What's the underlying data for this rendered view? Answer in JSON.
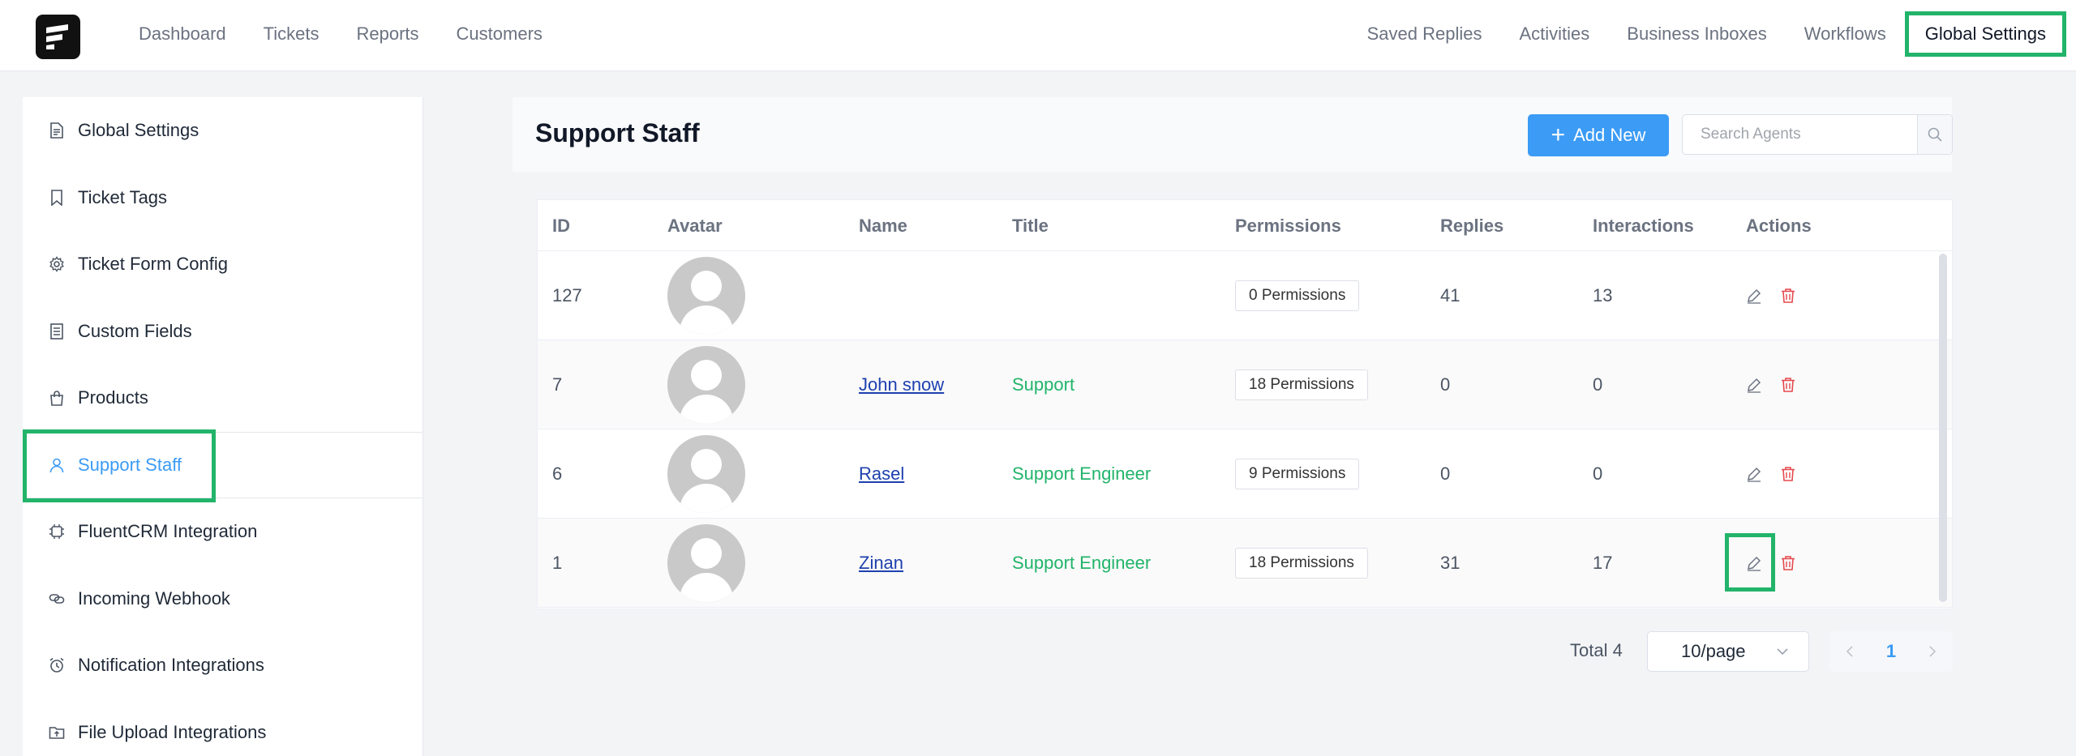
{
  "topnav": {
    "left": [
      "Dashboard",
      "Tickets",
      "Reports",
      "Customers"
    ],
    "right": [
      "Saved Replies",
      "Activities",
      "Business Inboxes",
      "Workflows"
    ],
    "active": "Global Settings"
  },
  "sidebar": {
    "items": [
      {
        "label": "Global Settings",
        "icon": "document-icon"
      },
      {
        "label": "Ticket Tags",
        "icon": "bookmark-icon"
      },
      {
        "label": "Ticket Form Config",
        "icon": "gear-icon"
      },
      {
        "label": "Custom Fields",
        "icon": "list-document-icon"
      },
      {
        "label": "Products",
        "icon": "shopping-bag-icon"
      },
      {
        "label": "Support Staff",
        "icon": "user-icon"
      },
      {
        "label": "FluentCRM Integration",
        "icon": "chip-icon"
      },
      {
        "label": "Incoming Webhook",
        "icon": "link-icon"
      },
      {
        "label": "Notification Integrations",
        "icon": "alarm-clock-icon"
      },
      {
        "label": "File Upload Integrations",
        "icon": "folder-upload-icon"
      }
    ],
    "active_index": 5
  },
  "page": {
    "title": "Support Staff",
    "add_label": "Add New",
    "search_placeholder": "Search Agents"
  },
  "table": {
    "columns": [
      "ID",
      "Avatar",
      "Name",
      "Title",
      "Permissions",
      "Replies",
      "Interactions",
      "Actions"
    ],
    "rows": [
      {
        "id": "127",
        "name": "",
        "title": "",
        "permissions": "0 Permissions",
        "replies": "41",
        "interactions": "13"
      },
      {
        "id": "7",
        "name": "John snow",
        "title": "Support",
        "permissions": "18 Permissions",
        "replies": "0",
        "interactions": "0"
      },
      {
        "id": "6",
        "name": "Rasel",
        "title": "Support Engineer",
        "permissions": "9 Permissions",
        "replies": "0",
        "interactions": "0"
      },
      {
        "id": "1",
        "name": "Zinan",
        "title": "Support Engineer",
        "permissions": "18 Permissions",
        "replies": "31",
        "interactions": "17"
      }
    ]
  },
  "pagination": {
    "total": "Total 4",
    "page_size": "10/page",
    "current_page": "1"
  },
  "colors": {
    "accent": "#3b9bf5",
    "highlight": "#22b46a",
    "danger": "#e5484d",
    "title_green": "#22b46a"
  }
}
